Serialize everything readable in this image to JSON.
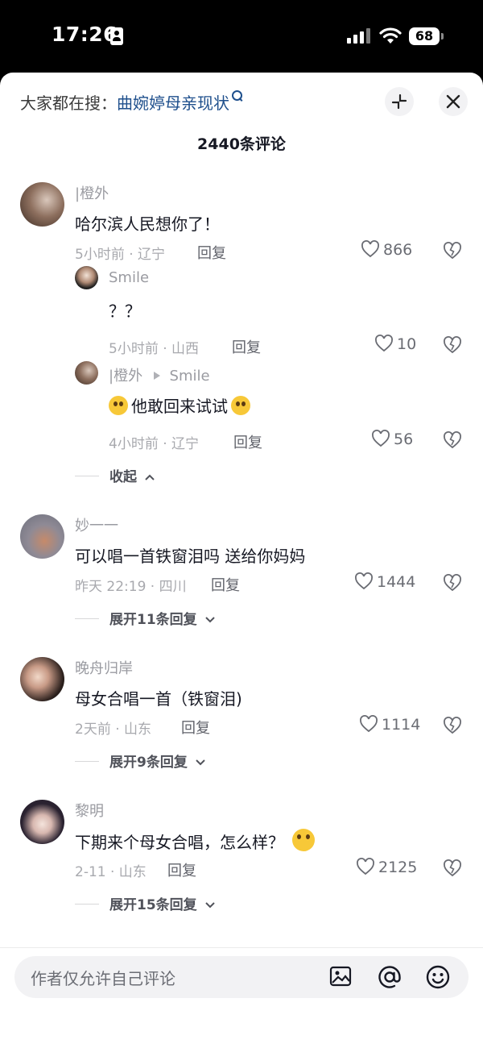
{
  "status_bar": {
    "time": "17:26",
    "battery": "68"
  },
  "header": {
    "search_prefix": "大家都在搜：",
    "search_query": "曲婉婷母亲现状",
    "comment_count": "2440条评论"
  },
  "comments": [
    {
      "username": "|橙外",
      "text": "哈尔滨人民想你了！",
      "meta": "5小时前 · 辽宁",
      "reply_label": "回复",
      "likes": "866",
      "replies": [
        {
          "username": "Smile",
          "text": "？？",
          "meta": "5小时前 · 山西",
          "reply_label": "回复",
          "likes": "10"
        },
        {
          "username": "|橙外",
          "reply_to": "Smile",
          "text": "他敢回来试试",
          "meta": "4小时前 · 辽宁",
          "reply_label": "回复",
          "likes": "56"
        }
      ],
      "collapse_label": "收起"
    },
    {
      "username": "妙一一",
      "text": "可以唱一首铁窗泪吗 送给你妈妈",
      "meta": "昨天 22:19 · 四川",
      "reply_label": "回复",
      "likes": "1444",
      "expand_label": "展开11条回复"
    },
    {
      "username": "晚舟归岸",
      "text": "母女合唱一首（铁窗泪)",
      "meta": "2天前 · 山东",
      "reply_label": "回复",
      "likes": "1114",
      "expand_label": "展开9条回复"
    },
    {
      "username": "黎明",
      "text": "下期来个母女合唱，怎么样？",
      "meta": "2-11 · 山东",
      "reply_label": "回复",
      "likes": "2125",
      "expand_label": "展开15条回复"
    }
  ],
  "input_bar": {
    "placeholder": "作者仅允许自己评论"
  },
  "colors": {
    "link": "#1e4f8c",
    "text": "#161823",
    "muted": "#a8a9ae",
    "sheet": "#ffffff"
  }
}
